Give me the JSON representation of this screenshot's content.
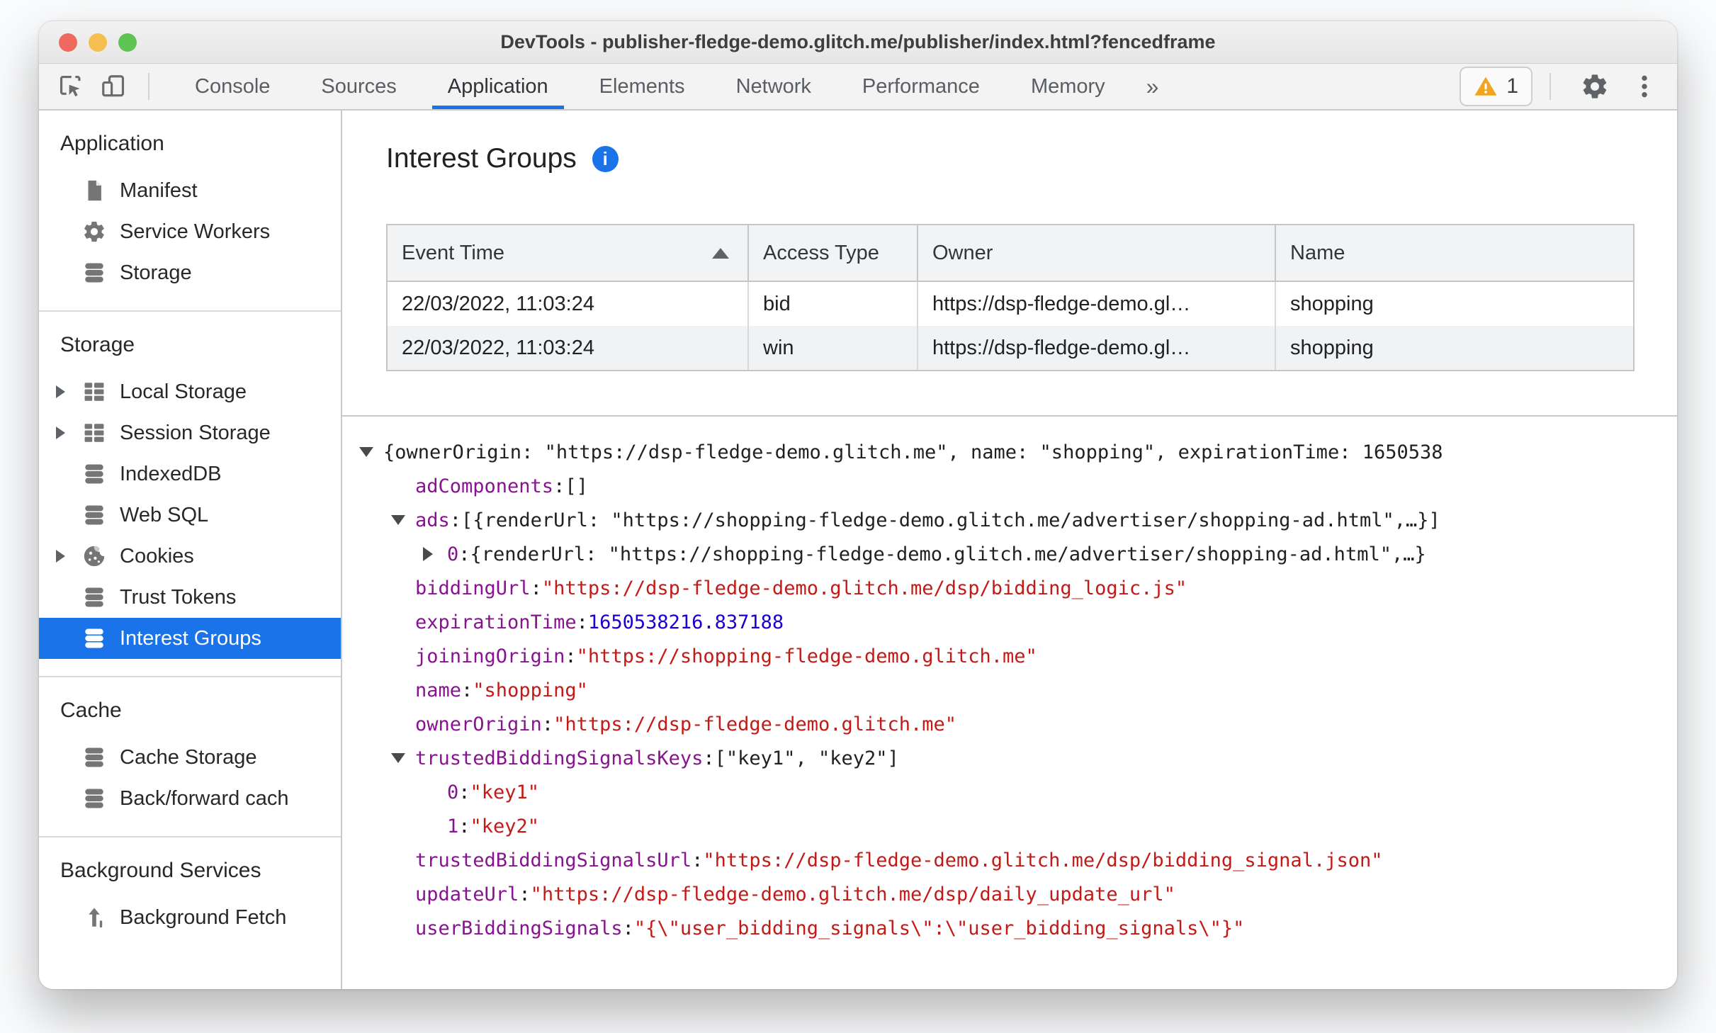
{
  "colors": {
    "accent": "#1a73e8",
    "tree_key": "#881391",
    "tree_string": "#c41a16",
    "tree_number": "#1c00cf",
    "warning": "#f0a51f"
  },
  "window": {
    "title": "DevTools - publisher-fledge-demo.glitch.me/publisher/index.html?fencedframe"
  },
  "toolbar": {
    "tabs": [
      {
        "label": "Console",
        "selected": false
      },
      {
        "label": "Sources",
        "selected": false
      },
      {
        "label": "Application",
        "selected": true
      },
      {
        "label": "Elements",
        "selected": false
      },
      {
        "label": "Network",
        "selected": false
      },
      {
        "label": "Performance",
        "selected": false
      },
      {
        "label": "Memory",
        "selected": false
      }
    ],
    "more_tabs_glyph": "»",
    "warning_count": "1"
  },
  "sidebar": {
    "sections": [
      {
        "title": "Application",
        "items": [
          {
            "label": "Manifest",
            "icon": "file-icon",
            "expandable": false,
            "selected": false
          },
          {
            "label": "Service Workers",
            "icon": "gear-icon",
            "expandable": false,
            "selected": false
          },
          {
            "label": "Storage",
            "icon": "database-icon",
            "expandable": false,
            "selected": false
          }
        ]
      },
      {
        "title": "Storage",
        "items": [
          {
            "label": "Local Storage",
            "icon": "grid-icon",
            "expandable": true,
            "selected": false
          },
          {
            "label": "Session Storage",
            "icon": "grid-icon",
            "expandable": true,
            "selected": false
          },
          {
            "label": "IndexedDB",
            "icon": "database-icon",
            "expandable": false,
            "selected": false
          },
          {
            "label": "Web SQL",
            "icon": "database-icon",
            "expandable": false,
            "selected": false
          },
          {
            "label": "Cookies",
            "icon": "cookie-icon",
            "expandable": true,
            "selected": false
          },
          {
            "label": "Trust Tokens",
            "icon": "database-icon",
            "expandable": false,
            "selected": false
          },
          {
            "label": "Interest Groups",
            "icon": "database-icon",
            "expandable": false,
            "selected": true
          }
        ]
      },
      {
        "title": "Cache",
        "items": [
          {
            "label": "Cache Storage",
            "icon": "database-icon",
            "expandable": false,
            "selected": false
          },
          {
            "label": "Back/forward cach",
            "icon": "database-icon",
            "expandable": false,
            "selected": false
          }
        ]
      },
      {
        "title": "Background Services",
        "items": [
          {
            "label": "Background Fetch",
            "icon": "fetch-icon",
            "expandable": false,
            "selected": false
          }
        ]
      }
    ]
  },
  "main": {
    "title": "Interest Groups",
    "table": {
      "columns": [
        "Event Time",
        "Access Type",
        "Owner",
        "Name"
      ],
      "sorted_column_index": 0,
      "rows": [
        [
          "22/03/2022, 11:03:24",
          "bid",
          "https://dsp-fledge-demo.gl…",
          "shopping"
        ],
        [
          "22/03/2022, 11:03:24",
          "win",
          "https://dsp-fledge-demo.gl…",
          "shopping"
        ]
      ]
    },
    "tree": {
      "lines": [
        {
          "indent": 0,
          "arrow": "down",
          "segments": [
            {
              "text": "{ownerOrigin: \"https://dsp-fledge-demo.glitch.me\", name: \"shopping\", expirationTime: 1650538",
              "type": "plain"
            }
          ]
        },
        {
          "indent": 1,
          "arrow": null,
          "segments": [
            {
              "text": "adComponents",
              "type": "key"
            },
            {
              "text": ": ",
              "type": "plain"
            },
            {
              "text": "[]",
              "type": "plain"
            }
          ]
        },
        {
          "indent": 1,
          "arrow": "down",
          "segments": [
            {
              "text": "ads",
              "type": "key"
            },
            {
              "text": ": ",
              "type": "plain"
            },
            {
              "text": "[{renderUrl: \"https://shopping-fledge-demo.glitch.me/advertiser/shopping-ad.html\",…}]",
              "type": "plain"
            }
          ]
        },
        {
          "indent": 2,
          "arrow": "right",
          "segments": [
            {
              "text": "0",
              "type": "key"
            },
            {
              "text": ": ",
              "type": "plain"
            },
            {
              "text": "{renderUrl: \"https://shopping-fledge-demo.glitch.me/advertiser/shopping-ad.html\",…}",
              "type": "plain"
            }
          ]
        },
        {
          "indent": 1,
          "arrow": null,
          "segments": [
            {
              "text": "biddingUrl",
              "type": "key"
            },
            {
              "text": ": ",
              "type": "plain"
            },
            {
              "text": "\"https://dsp-fledge-demo.glitch.me/dsp/bidding_logic.js\"",
              "type": "string"
            }
          ]
        },
        {
          "indent": 1,
          "arrow": null,
          "segments": [
            {
              "text": "expirationTime",
              "type": "key"
            },
            {
              "text": ": ",
              "type": "plain"
            },
            {
              "text": "1650538216.837188",
              "type": "number"
            }
          ]
        },
        {
          "indent": 1,
          "arrow": null,
          "segments": [
            {
              "text": "joiningOrigin",
              "type": "key"
            },
            {
              "text": ": ",
              "type": "plain"
            },
            {
              "text": "\"https://shopping-fledge-demo.glitch.me\"",
              "type": "string"
            }
          ]
        },
        {
          "indent": 1,
          "arrow": null,
          "segments": [
            {
              "text": "name",
              "type": "key"
            },
            {
              "text": ": ",
              "type": "plain"
            },
            {
              "text": "\"shopping\"",
              "type": "string"
            }
          ]
        },
        {
          "indent": 1,
          "arrow": null,
          "segments": [
            {
              "text": "ownerOrigin",
              "type": "key"
            },
            {
              "text": ": ",
              "type": "plain"
            },
            {
              "text": "\"https://dsp-fledge-demo.glitch.me\"",
              "type": "string"
            }
          ]
        },
        {
          "indent": 1,
          "arrow": "down",
          "segments": [
            {
              "text": "trustedBiddingSignalsKeys",
              "type": "key"
            },
            {
              "text": ": ",
              "type": "plain"
            },
            {
              "text": "[\"key1\", \"key2\"]",
              "type": "plain"
            }
          ]
        },
        {
          "indent": 2,
          "arrow": null,
          "segments": [
            {
              "text": "0",
              "type": "key"
            },
            {
              "text": ": ",
              "type": "plain"
            },
            {
              "text": "\"key1\"",
              "type": "string"
            }
          ]
        },
        {
          "indent": 2,
          "arrow": null,
          "segments": [
            {
              "text": "1",
              "type": "key"
            },
            {
              "text": ": ",
              "type": "plain"
            },
            {
              "text": "\"key2\"",
              "type": "string"
            }
          ]
        },
        {
          "indent": 1,
          "arrow": null,
          "segments": [
            {
              "text": "trustedBiddingSignalsUrl",
              "type": "key"
            },
            {
              "text": ": ",
              "type": "plain"
            },
            {
              "text": "\"https://dsp-fledge-demo.glitch.me/dsp/bidding_signal.json\"",
              "type": "string"
            }
          ]
        },
        {
          "indent": 1,
          "arrow": null,
          "segments": [
            {
              "text": "updateUrl",
              "type": "key"
            },
            {
              "text": ": ",
              "type": "plain"
            },
            {
              "text": "\"https://dsp-fledge-demo.glitch.me/dsp/daily_update_url\"",
              "type": "string"
            }
          ]
        },
        {
          "indent": 1,
          "arrow": null,
          "segments": [
            {
              "text": "userBiddingSignals",
              "type": "key"
            },
            {
              "text": ": ",
              "type": "plain"
            },
            {
              "text": "\"{\\\"user_bidding_signals\\\":\\\"user_bidding_signals\\\"}\"",
              "type": "string"
            }
          ]
        }
      ]
    }
  }
}
